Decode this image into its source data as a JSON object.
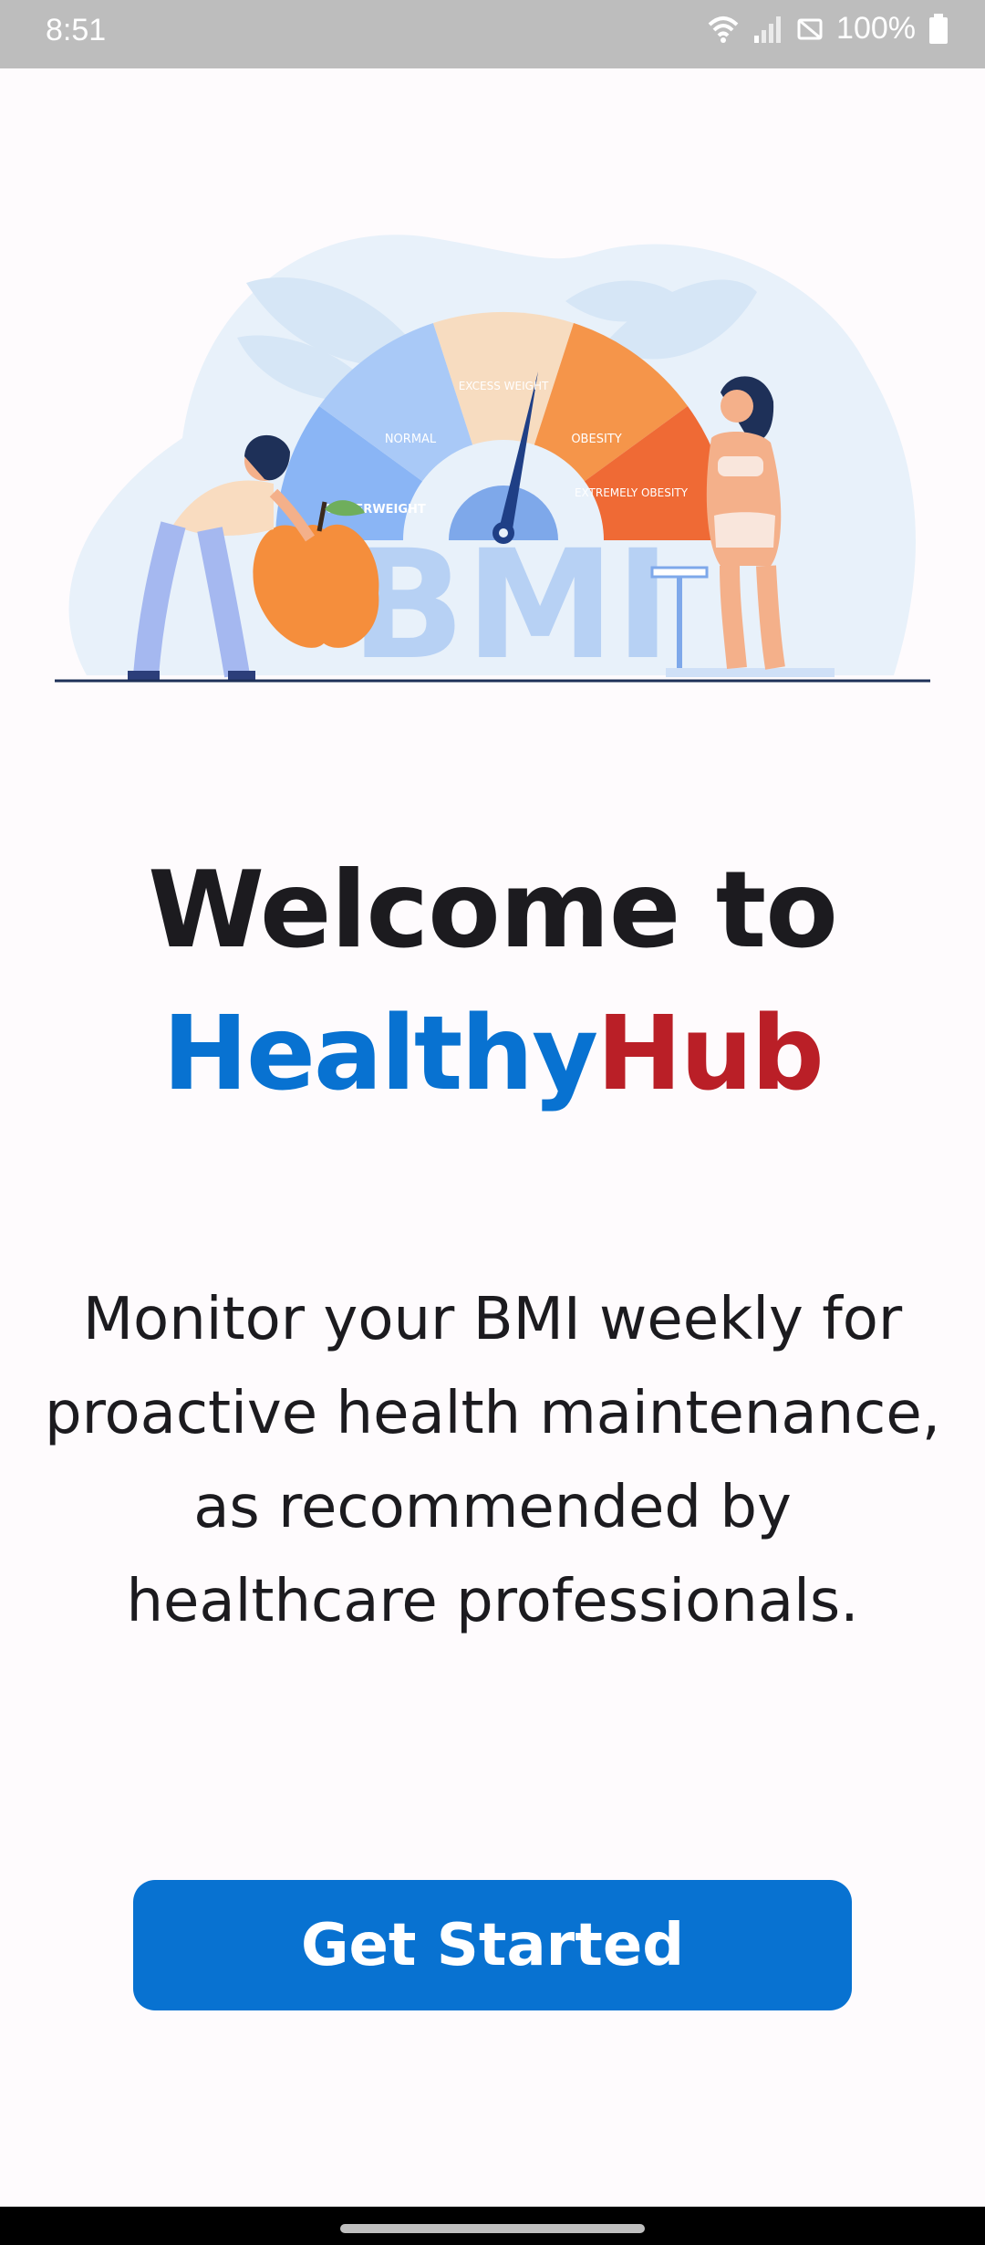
{
  "status_bar": {
    "time": "8:51",
    "battery_text": "100%",
    "icons": [
      "wifi-icon",
      "signal-icon",
      "no-sim-icon",
      "battery-icon"
    ]
  },
  "hero": {
    "gauge_segments": [
      "UNDERWEIGHT",
      "NORMAL",
      "EXCESS WEIGHT",
      "OBESITY",
      "EXTREMELY OBESITY"
    ],
    "bmi_text": "BMI"
  },
  "welcome": {
    "title": "Welcome to",
    "brand_part1": "Healthy",
    "brand_part2": "Hub"
  },
  "description": "Monitor your BMI weekly for proactive health maintenance, as recommended by healthcare professionals.",
  "cta": {
    "label": "Get Started"
  },
  "colors": {
    "primary": "#0872d1",
    "accent": "#ba1f27",
    "text": "#1c1b1f",
    "background": "#fefbfd"
  }
}
